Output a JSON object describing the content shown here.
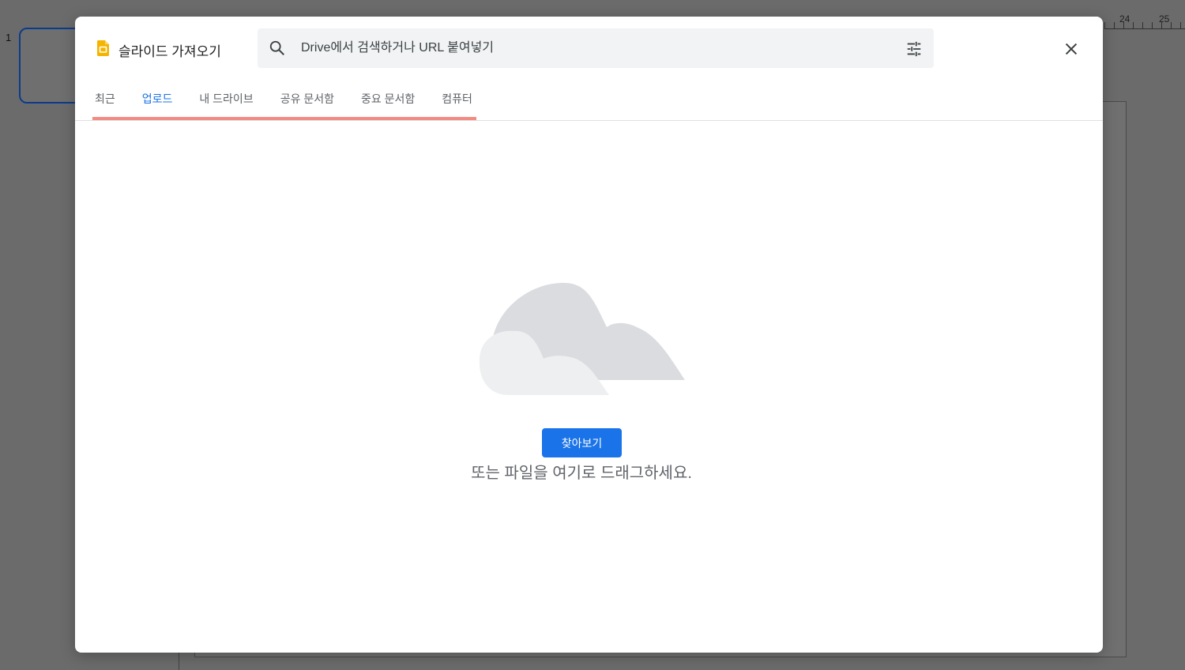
{
  "background": {
    "ruler_numbers": [
      "24",
      "25"
    ],
    "slide_number": "1"
  },
  "dialog": {
    "title": "슬라이드 가져오기",
    "search": {
      "placeholder": "Drive에서 검색하거나 URL 붙여넣기",
      "value": ""
    },
    "tabs": [
      {
        "label": "최근",
        "active": false
      },
      {
        "label": "업로드",
        "active": true
      },
      {
        "label": "내 드라이브",
        "active": false
      },
      {
        "label": "공유 문서함",
        "active": false
      },
      {
        "label": "중요 문서함",
        "active": false
      },
      {
        "label": "컴퓨터",
        "active": false
      }
    ],
    "upload": {
      "browse_label": "찾아보기",
      "drag_text": "또는 파일을 여기로 드래그하세요."
    }
  },
  "icons": {
    "app": "google-slides-icon",
    "search": "search-icon",
    "tune": "tune-icon",
    "close": "close-icon",
    "illustration": "cloud-illustration"
  },
  "colors": {
    "accent": "#1a73e8",
    "tab_underline": "#f28b82",
    "slides_yellow": "#f4b400",
    "overlay": "#6b6b6b"
  }
}
